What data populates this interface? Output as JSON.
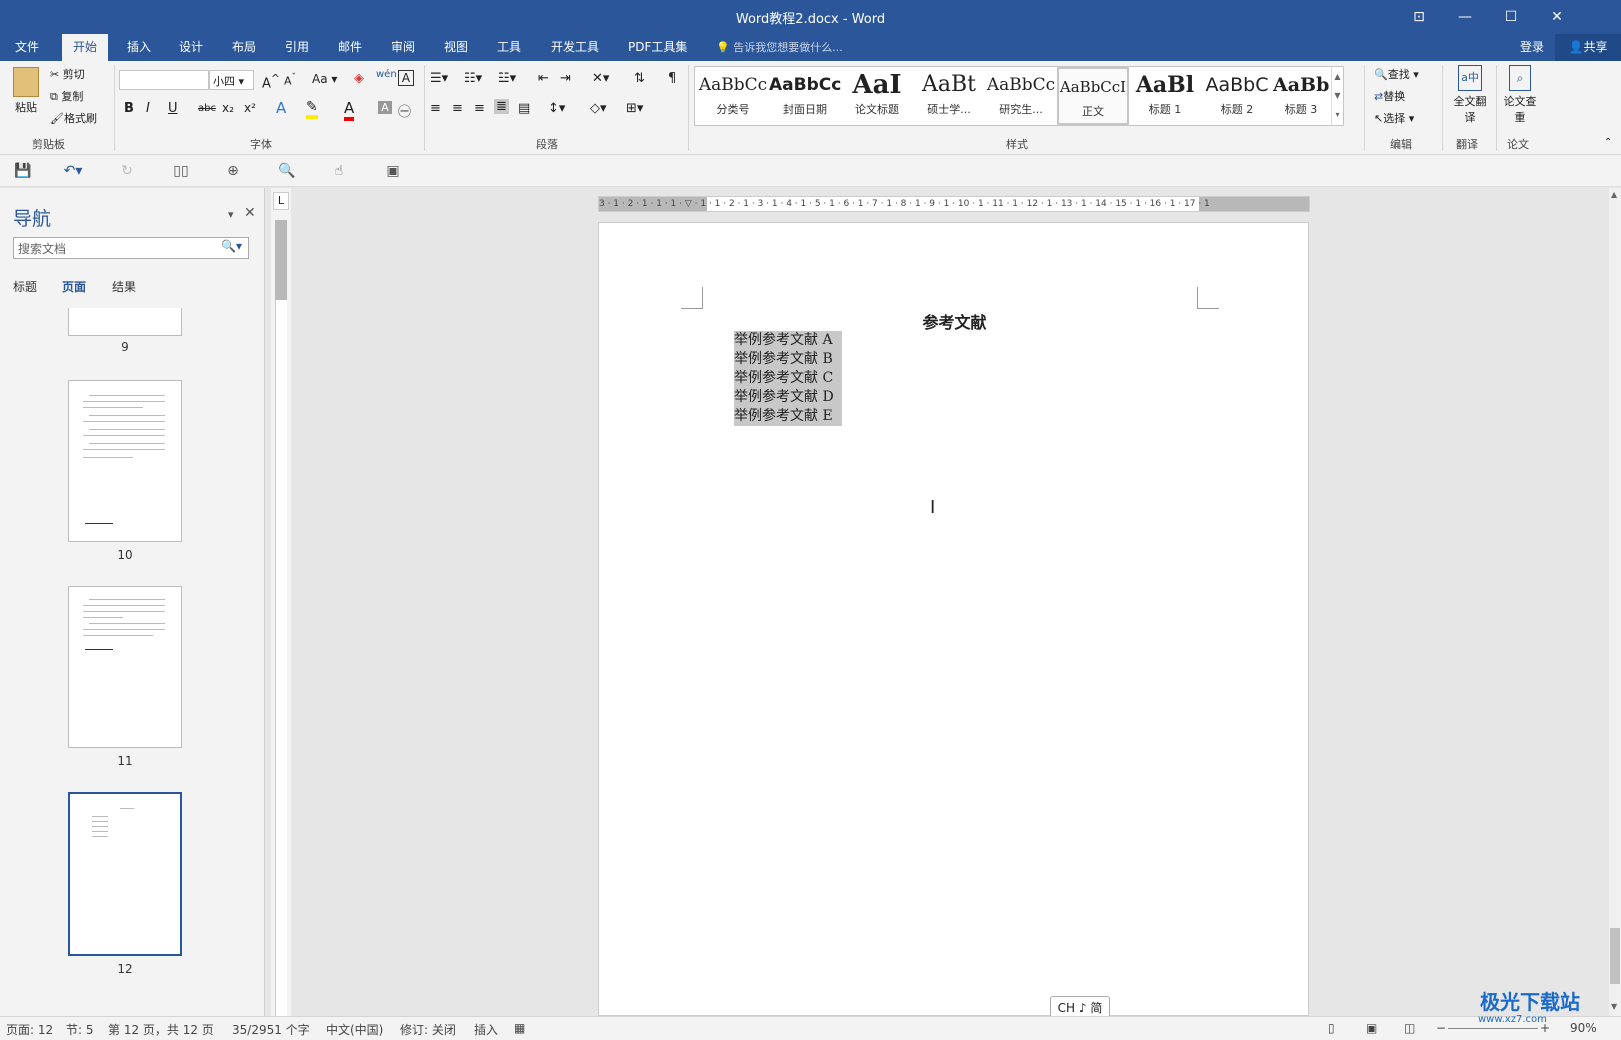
{
  "window": {
    "title": "Word教程2.docx - Word",
    "restore_icon": "ribbon-display-icon",
    "min": "—",
    "max": "☐",
    "close": "✕"
  },
  "tabs": [
    "文件",
    "开始",
    "插入",
    "设计",
    "布局",
    "引用",
    "邮件",
    "审阅",
    "视图",
    "工具",
    "开发工具",
    "PDF工具集"
  ],
  "active_tab": "开始",
  "tellme": "告诉我您想要做什么...",
  "account": {
    "login": "登录",
    "share": "共享"
  },
  "clipboard": {
    "paste": "粘贴",
    "cut": "剪切",
    "copy": "复制",
    "format_painter": "格式刷",
    "group": "剪贴板"
  },
  "font": {
    "family": "",
    "size": "小四",
    "aa": "Aa",
    "group": "字体",
    "bold": "B",
    "italic": "I",
    "underline": "U",
    "strike": "abc",
    "sub": "x₂",
    "sup": "x²",
    "wen": "wén",
    "a_big": "A",
    "font_color": "A"
  },
  "paragraph": {
    "group": "段落"
  },
  "styles": {
    "group": "样式",
    "items": [
      {
        "preview": "AaBbCc",
        "name": "分类号"
      },
      {
        "preview": "AaBbCc",
        "name": "封面日期"
      },
      {
        "preview": "AaI",
        "name": "论文标题"
      },
      {
        "preview": "AaBt",
        "name": "硕士学..."
      },
      {
        "preview": "AaBbCc",
        "name": "研究生..."
      },
      {
        "preview": "AaBbCcI",
        "name": "正文"
      },
      {
        "preview": "AaBl",
        "name": "标题 1"
      },
      {
        "preview": "AaBbC",
        "name": "标题 2"
      },
      {
        "preview": "AaBb",
        "name": "标题 3"
      }
    ]
  },
  "editing": {
    "find": "查找",
    "replace": "替换",
    "select": "选择",
    "group": "编辑"
  },
  "translate": {
    "full": "全文翻译",
    "group": "翻译"
  },
  "paper": {
    "check": "论文查重",
    "group": "论文"
  },
  "nav_pane": {
    "title": "导航",
    "search_placeholder": "搜索文档",
    "tabs": [
      "标题",
      "页面",
      "结果"
    ],
    "active_tab": "页面",
    "pages": [
      {
        "num": "9"
      },
      {
        "num": "10"
      },
      {
        "num": "11"
      },
      {
        "num": "12"
      }
    ]
  },
  "ruler": {
    "corner": "L",
    "labels": "3 · 1 · 2 · 1 · 1 · 1 · ▽ · 1 · 1 · 2 · 1 · 3 · 1 · 4 · 1 · 5 · 1 · 6 · 1 · 7 · 1 · 8 · 1 · 9 · 1 · 10 · 1 · 11 · 1 · 12 · 1 · 13 · 1 · 14 · 15 · 1 · 16 · 1 · 17 · 1"
  },
  "document": {
    "heading": "参考文献",
    "references": [
      "举例参考文献 A",
      "举例参考文献 B",
      "举例参考文献 C",
      "举例参考文献 D",
      "举例参考文献 E"
    ]
  },
  "ime": "CH ♪ 简",
  "status": {
    "page": "页面: 12",
    "section": "节: 5",
    "page_of": "第 12 页，共 12 页",
    "words": "35/2951 个字",
    "lang": "中文(中国)",
    "track": "修订: 关闭",
    "insert": "插入",
    "zoom": "90%"
  },
  "watermark": {
    "text": "极光下载站",
    "url": "www.xz7.com"
  }
}
